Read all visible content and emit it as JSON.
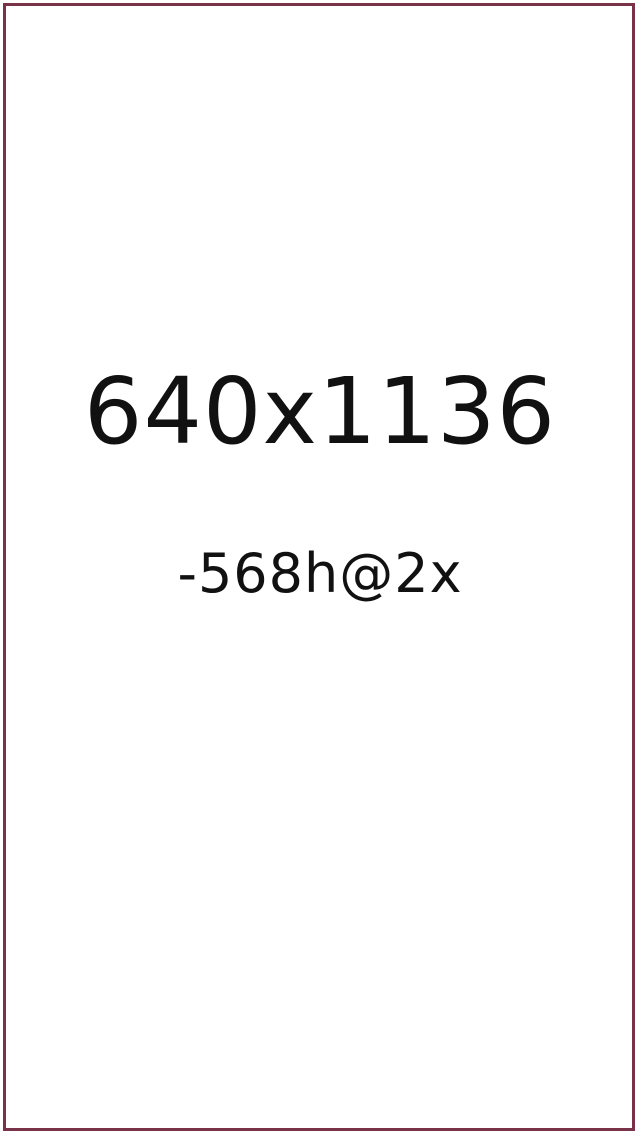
{
  "placeholder": {
    "dimensions_text": "640x1136",
    "suffix_text": "-568h@2x",
    "border_color": "#7a3248",
    "background_color": "#ffffff",
    "text_color": "#111111"
  }
}
